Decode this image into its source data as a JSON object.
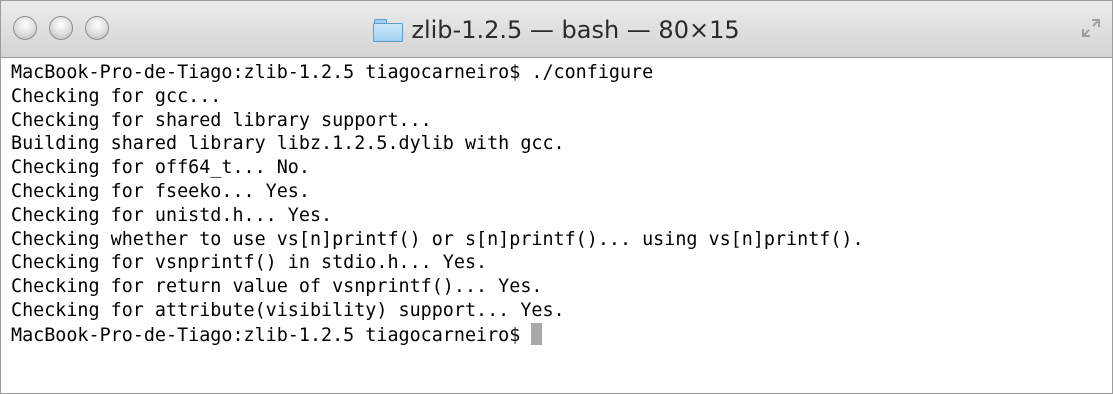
{
  "window": {
    "title": "zlib-1.2.5 — bash — 80×15"
  },
  "terminal": {
    "lines": [
      "MacBook-Pro-de-Tiago:zlib-1.2.5 tiagocarneiro$ ./configure",
      "Checking for gcc...",
      "Checking for shared library support...",
      "Building shared library libz.1.2.5.dylib with gcc.",
      "Checking for off64_t... No.",
      "Checking for fseeko... Yes.",
      "Checking for unistd.h... Yes.",
      "Checking whether to use vs[n]printf() or s[n]printf()... using vs[n]printf().",
      "Checking for vsnprintf() in stdio.h... Yes.",
      "Checking for return value of vsnprintf()... Yes.",
      "Checking for attribute(visibility) support... Yes."
    ],
    "prompt": "MacBook-Pro-de-Tiago:zlib-1.2.5 tiagocarneiro$ "
  },
  "icons": {
    "close": "close-icon",
    "minimize": "minimize-icon",
    "zoom": "zoom-icon",
    "folder": "folder-icon",
    "fullscreen": "fullscreen-icon"
  }
}
